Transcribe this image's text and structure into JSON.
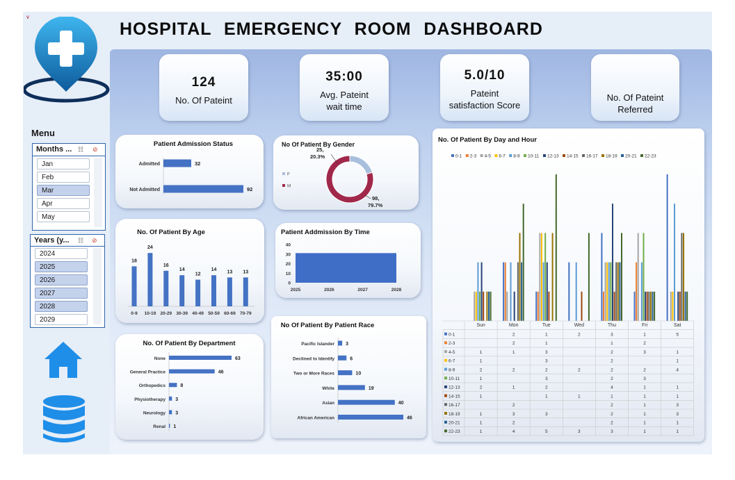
{
  "title": "HOSPITAL  EMERGENCY  ROOM  DASHBOARD",
  "corner_mark": "v",
  "menu_label": "Menu",
  "kpis": [
    {
      "value": "124",
      "label_line1": "No. Of Pateint",
      "label_line2": ""
    },
    {
      "value": "35:00",
      "label_line1": "Avg. Pateint",
      "label_line2": "wait time"
    },
    {
      "value": "5.0/10",
      "label_line1": "Pateint",
      "label_line2": "satisfaction Score"
    },
    {
      "value": "",
      "label_line1": "No. Of Pateint",
      "label_line2": "Referred"
    }
  ],
  "months_slicer": {
    "header": "Months ...",
    "items": [
      {
        "label": "Jan",
        "selected": false
      },
      {
        "label": "Feb",
        "selected": false
      },
      {
        "label": "Mar",
        "selected": true
      },
      {
        "label": "Apr",
        "selected": false
      },
      {
        "label": "May",
        "selected": false
      }
    ]
  },
  "years_slicer": {
    "header": "Years (y...",
    "items": [
      {
        "label": "2024",
        "selected": false
      },
      {
        "label": "2025",
        "selected": true
      },
      {
        "label": "2026",
        "selected": true
      },
      {
        "label": "2027",
        "selected": true
      },
      {
        "label": "2028",
        "selected": true
      },
      {
        "label": "2029",
        "selected": false
      }
    ]
  },
  "icons": {
    "logo": "hospital-location-pin-icon",
    "home": "home-icon",
    "database": "database-icon",
    "multiselect": "multi-select-icon",
    "clear_filter": "clear-filter-icon"
  },
  "colors": {
    "bar": "#4472c4",
    "accent_blue": "#1a8fd1",
    "dark_navy": "#0e2f5a",
    "donut_f": "#a8bfdc",
    "donut_m": "#a0284a"
  },
  "chart_data": [
    {
      "id": "admission_status",
      "type": "bar",
      "orientation": "horizontal",
      "title": "Patient Admission Status",
      "categories": [
        "Admitted",
        "Not Admitted"
      ],
      "values": [
        32,
        92
      ]
    },
    {
      "id": "gender",
      "type": "pie",
      "style": "donut",
      "title": "No Of Patient By Gender",
      "categories": [
        "F",
        "M"
      ],
      "values": [
        25,
        98
      ],
      "percent_labels": [
        "20.3%",
        "79.7%"
      ]
    },
    {
      "id": "age",
      "type": "bar",
      "title": "No. Of  Patient By Age",
      "categories": [
        "0-9",
        "10-19",
        "20-29",
        "30-39",
        "40-49",
        "50-59",
        "60-69",
        "70-79"
      ],
      "values": [
        18,
        24,
        16,
        14,
        12,
        14,
        13,
        13
      ]
    },
    {
      "id": "admission_time",
      "type": "area",
      "title": "Patient Addmission By Time",
      "x": [
        "2025",
        "2026",
        "2027",
        "2028"
      ],
      "values": [
        31,
        31,
        31,
        31
      ],
      "y_ticks": [
        0,
        10,
        20,
        30,
        40
      ],
      "ylim": [
        0,
        40
      ]
    },
    {
      "id": "department",
      "type": "bar",
      "orientation": "horizontal",
      "title": "No. Of  Patient By Department",
      "categories": [
        "None",
        "General Practice",
        "Orthopedics",
        "Physiotherapy",
        "Neurology",
        "Renal"
      ],
      "values": [
        63,
        46,
        8,
        3,
        3,
        1
      ]
    },
    {
      "id": "race",
      "type": "bar",
      "orientation": "horizontal",
      "title": "No Of Patient By Patient Race",
      "categories": [
        "Pacific Islander",
        "Declined to Identify",
        "Two or More Races",
        "White",
        "Asian",
        "African American"
      ],
      "values": [
        3,
        6,
        10,
        19,
        40,
        46
      ]
    },
    {
      "id": "day_hour",
      "type": "bar",
      "title": "No. Of  Patient By Day and Hour",
      "categories": [
        "Sun",
        "Mon",
        "Tue",
        "Wed",
        "Thu",
        "Fri",
        "Sat"
      ],
      "ylim": [
        0,
        5
      ],
      "series": [
        {
          "name": "0-1",
          "color": "#4472c4",
          "values": [
            null,
            2,
            1,
            2,
            3,
            1,
            5
          ]
        },
        {
          "name": "2-3",
          "color": "#ed7d31",
          "values": [
            null,
            2,
            1,
            null,
            1,
            2,
            null
          ]
        },
        {
          "name": "4-5",
          "color": "#a5a5a5",
          "values": [
            1,
            1,
            3,
            null,
            2,
            3,
            1
          ]
        },
        {
          "name": "6-7",
          "color": "#ffc000",
          "values": [
            1,
            null,
            3,
            null,
            2,
            null,
            1
          ]
        },
        {
          "name": "8-9",
          "color": "#5b9bd5",
          "values": [
            2,
            2,
            2,
            2,
            2,
            2,
            4
          ]
        },
        {
          "name": "10-11",
          "color": "#70ad47",
          "values": [
            1,
            null,
            3,
            null,
            2,
            3,
            null
          ]
        },
        {
          "name": "12-13",
          "color": "#264478",
          "values": [
            2,
            1,
            2,
            null,
            4,
            1,
            1
          ]
        },
        {
          "name": "14-15",
          "color": "#9e480e",
          "values": [
            1,
            null,
            1,
            1,
            1,
            1,
            1
          ]
        },
        {
          "name": "16-17",
          "color": "#636363",
          "values": [
            null,
            2,
            null,
            null,
            2,
            1,
            3
          ]
        },
        {
          "name": "18-19",
          "color": "#997300",
          "values": [
            1,
            3,
            3,
            null,
            2,
            1,
            3
          ]
        },
        {
          "name": "20-21",
          "color": "#255e91",
          "values": [
            1,
            2,
            null,
            null,
            2,
            1,
            1
          ]
        },
        {
          "name": "22-23",
          "color": "#43682b",
          "values": [
            1,
            4,
            5,
            3,
            3,
            1,
            1
          ]
        }
      ]
    }
  ]
}
